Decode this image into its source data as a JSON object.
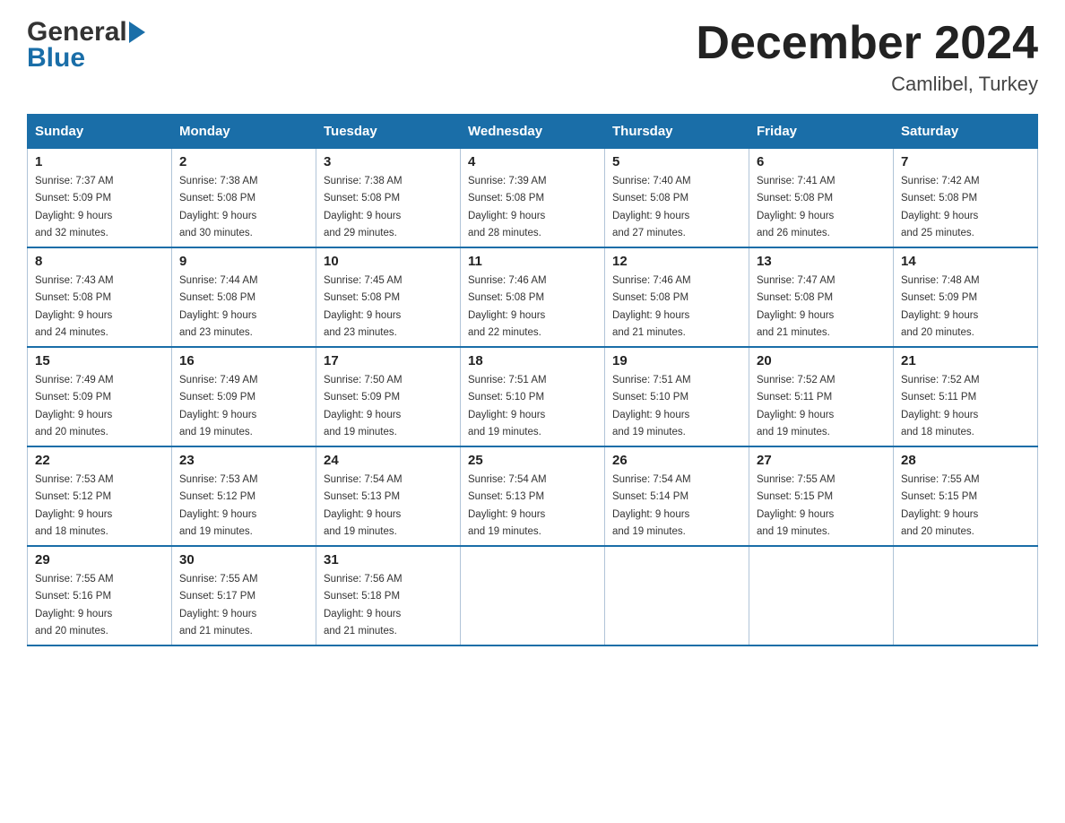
{
  "header": {
    "logo_general": "General",
    "logo_blue": "Blue",
    "month_title": "December 2024",
    "location": "Camlibel, Turkey"
  },
  "days_of_week": [
    "Sunday",
    "Monday",
    "Tuesday",
    "Wednesday",
    "Thursday",
    "Friday",
    "Saturday"
  ],
  "weeks": [
    [
      {
        "day": "1",
        "sunrise": "7:37 AM",
        "sunset": "5:09 PM",
        "daylight": "9 hours and 32 minutes."
      },
      {
        "day": "2",
        "sunrise": "7:38 AM",
        "sunset": "5:08 PM",
        "daylight": "9 hours and 30 minutes."
      },
      {
        "day": "3",
        "sunrise": "7:38 AM",
        "sunset": "5:08 PM",
        "daylight": "9 hours and 29 minutes."
      },
      {
        "day": "4",
        "sunrise": "7:39 AM",
        "sunset": "5:08 PM",
        "daylight": "9 hours and 28 minutes."
      },
      {
        "day": "5",
        "sunrise": "7:40 AM",
        "sunset": "5:08 PM",
        "daylight": "9 hours and 27 minutes."
      },
      {
        "day": "6",
        "sunrise": "7:41 AM",
        "sunset": "5:08 PM",
        "daylight": "9 hours and 26 minutes."
      },
      {
        "day": "7",
        "sunrise": "7:42 AM",
        "sunset": "5:08 PM",
        "daylight": "9 hours and 25 minutes."
      }
    ],
    [
      {
        "day": "8",
        "sunrise": "7:43 AM",
        "sunset": "5:08 PM",
        "daylight": "9 hours and 24 minutes."
      },
      {
        "day": "9",
        "sunrise": "7:44 AM",
        "sunset": "5:08 PM",
        "daylight": "9 hours and 23 minutes."
      },
      {
        "day": "10",
        "sunrise": "7:45 AM",
        "sunset": "5:08 PM",
        "daylight": "9 hours and 23 minutes."
      },
      {
        "day": "11",
        "sunrise": "7:46 AM",
        "sunset": "5:08 PM",
        "daylight": "9 hours and 22 minutes."
      },
      {
        "day": "12",
        "sunrise": "7:46 AM",
        "sunset": "5:08 PM",
        "daylight": "9 hours and 21 minutes."
      },
      {
        "day": "13",
        "sunrise": "7:47 AM",
        "sunset": "5:08 PM",
        "daylight": "9 hours and 21 minutes."
      },
      {
        "day": "14",
        "sunrise": "7:48 AM",
        "sunset": "5:09 PM",
        "daylight": "9 hours and 20 minutes."
      }
    ],
    [
      {
        "day": "15",
        "sunrise": "7:49 AM",
        "sunset": "5:09 PM",
        "daylight": "9 hours and 20 minutes."
      },
      {
        "day": "16",
        "sunrise": "7:49 AM",
        "sunset": "5:09 PM",
        "daylight": "9 hours and 19 minutes."
      },
      {
        "day": "17",
        "sunrise": "7:50 AM",
        "sunset": "5:09 PM",
        "daylight": "9 hours and 19 minutes."
      },
      {
        "day": "18",
        "sunrise": "7:51 AM",
        "sunset": "5:10 PM",
        "daylight": "9 hours and 19 minutes."
      },
      {
        "day": "19",
        "sunrise": "7:51 AM",
        "sunset": "5:10 PM",
        "daylight": "9 hours and 19 minutes."
      },
      {
        "day": "20",
        "sunrise": "7:52 AM",
        "sunset": "5:11 PM",
        "daylight": "9 hours and 19 minutes."
      },
      {
        "day": "21",
        "sunrise": "7:52 AM",
        "sunset": "5:11 PM",
        "daylight": "9 hours and 18 minutes."
      }
    ],
    [
      {
        "day": "22",
        "sunrise": "7:53 AM",
        "sunset": "5:12 PM",
        "daylight": "9 hours and 18 minutes."
      },
      {
        "day": "23",
        "sunrise": "7:53 AM",
        "sunset": "5:12 PM",
        "daylight": "9 hours and 19 minutes."
      },
      {
        "day": "24",
        "sunrise": "7:54 AM",
        "sunset": "5:13 PM",
        "daylight": "9 hours and 19 minutes."
      },
      {
        "day": "25",
        "sunrise": "7:54 AM",
        "sunset": "5:13 PM",
        "daylight": "9 hours and 19 minutes."
      },
      {
        "day": "26",
        "sunrise": "7:54 AM",
        "sunset": "5:14 PM",
        "daylight": "9 hours and 19 minutes."
      },
      {
        "day": "27",
        "sunrise": "7:55 AM",
        "sunset": "5:15 PM",
        "daylight": "9 hours and 19 minutes."
      },
      {
        "day": "28",
        "sunrise": "7:55 AM",
        "sunset": "5:15 PM",
        "daylight": "9 hours and 20 minutes."
      }
    ],
    [
      {
        "day": "29",
        "sunrise": "7:55 AM",
        "sunset": "5:16 PM",
        "daylight": "9 hours and 20 minutes."
      },
      {
        "day": "30",
        "sunrise": "7:55 AM",
        "sunset": "5:17 PM",
        "daylight": "9 hours and 21 minutes."
      },
      {
        "day": "31",
        "sunrise": "7:56 AM",
        "sunset": "5:18 PM",
        "daylight": "9 hours and 21 minutes."
      },
      null,
      null,
      null,
      null
    ]
  ]
}
